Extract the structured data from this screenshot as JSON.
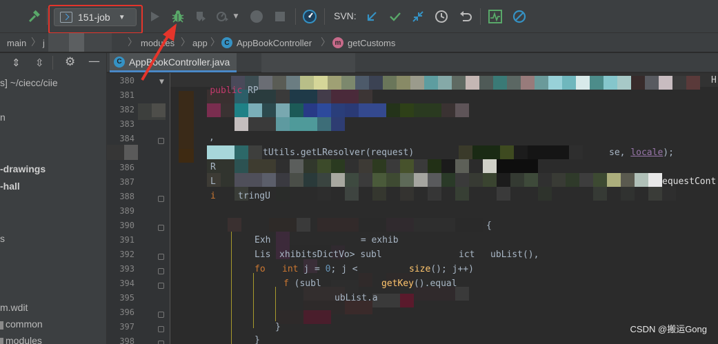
{
  "toolbar": {
    "run_config": "151-job",
    "svn_label": "SVN:"
  },
  "breadcrumb": {
    "items": [
      "main",
      "j",
      "modules",
      "app",
      "AppBookController",
      "getCustoms"
    ]
  },
  "project": {
    "root_suffix": "s] ~/ciecc/ciie",
    "items": [
      "n",
      "-drawings",
      "-hall",
      "s",
      "m.wdit",
      "common",
      "modules"
    ]
  },
  "editor": {
    "tab_title": "AppBookController.java",
    "line_numbers": [
      "380",
      "381",
      "382",
      "383",
      "384",
      "386",
      "387",
      "388",
      "389",
      "390",
      "391",
      "392",
      "393",
      "394",
      "395",
      "396",
      "397",
      "398"
    ],
    "code": {
      "l380_kw": "public",
      "l380_rest": " RP ",
      "l380_right": "H",
      "l384_a": "tUtils.getL",
      "l384_b": "Resolver(request)",
      "l384_c": "se, ",
      "l384_d": "locale",
      "l384_e": ");",
      "l386": "R",
      "l387_a": "L",
      "l387_b": "equestCont",
      "l388_a": "i",
      "l388_b": "tringU",
      "l390": "{",
      "l391_a": "Exh",
      "l391_b": " = exhib",
      "l392_a": "Lis",
      "l392_b": "xhibitsDictVo",
      "l392_c": "> subl",
      "l392_d": "ict",
      "l392_e": "ubList",
      "l392_f": "(),",
      "l393_a": "fo",
      "l393_kw": "int",
      "l393_b": " j = ",
      "l393_num": "0",
      "l393_c": "; j <",
      "l393_d": "size",
      "l393_e": "(); j++)",
      "l394_a": "f",
      "l394_b": " (subl",
      "l394_c": "getKey",
      "l394_d": "().equal",
      "l395": "ubList.a",
      "l397": "}",
      "l398": "}"
    }
  },
  "watermark": "CSDN @搬运Gong",
  "colors": {
    "annotation_red": "#e5352b",
    "accent_blue": "#4a88c7",
    "debug_green": "#59a869",
    "svn_blue": "#3592c4"
  }
}
